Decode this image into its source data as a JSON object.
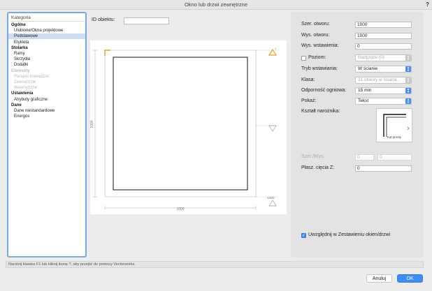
{
  "window": {
    "title": "Okno lub drzwi zewnętrzne",
    "help": "?"
  },
  "category_tree": {
    "header": "Kategoria",
    "items": [
      {
        "label": "Ogólne",
        "kind": "cat"
      },
      {
        "label": "Ulubione/Okna projektowe",
        "kind": "sub"
      },
      {
        "label": "Podstawowe",
        "kind": "sub",
        "selected": true
      },
      {
        "label": "Etykieta",
        "kind": "sub"
      },
      {
        "label": "Stolarka",
        "kind": "cat"
      },
      {
        "label": "Ramy",
        "kind": "sub"
      },
      {
        "label": "Skrzydła",
        "kind": "sub"
      },
      {
        "label": "Dodatki",
        "kind": "sub"
      },
      {
        "label": "Elementy",
        "kind": "cat",
        "disabled": true
      },
      {
        "label": "Parapet krawędzie",
        "kind": "sub",
        "disabled": true
      },
      {
        "label": "Zewnętrzne",
        "kind": "sub",
        "disabled": true
      },
      {
        "label": "Wewnętrzne",
        "kind": "sub",
        "disabled": true
      },
      {
        "label": "Ustawienia",
        "kind": "cat"
      },
      {
        "label": "Atrybuty graficzne",
        "kind": "sub"
      },
      {
        "label": "Dane",
        "kind": "cat"
      },
      {
        "label": "Dane niestandardowe",
        "kind": "sub"
      },
      {
        "label": "Energos",
        "kind": "sub"
      }
    ]
  },
  "object_id": {
    "label": "ID obiektu:",
    "value": ""
  },
  "preview": {
    "height_dim": "1000",
    "width_dim": "1000",
    "right_dim": "-1000",
    "top_tag": "0"
  },
  "form": {
    "width": {
      "label": "Szer. otworu:",
      "value": "1000"
    },
    "height": {
      "label": "Wys. otworu:",
      "value": "1000"
    },
    "insert_height": {
      "label": "Wys. wstawienia:",
      "value": "0"
    },
    "level": {
      "label": "Poziom:",
      "value": "Nadproże (0)",
      "checked": false
    },
    "insert_mode": {
      "label": "Tryb wstawiania:",
      "value": "W ścianie"
    },
    "class": {
      "label": "Klasa:",
      "value": "31 otwory w ściana..."
    },
    "fire": {
      "label": "Odporność ogniowa:",
      "value": "15 min"
    },
    "show": {
      "label": "Pokaż:",
      "value": "Tekst"
    },
    "corner": {
      "label": "Kształt narożnika:",
      "caption": "Kąt prosty"
    },
    "ratio": {
      "label": "Szer./Wys.",
      "value_a": "0",
      "value_b": "0"
    },
    "cut_plane": {
      "label": "Płasz. cięcia Z:",
      "value": "0"
    },
    "schedule": {
      "label": "Uwzględnij w Zestawieniu okien/drzwi",
      "checked": true
    }
  },
  "status": {
    "text": "Naciśnij klawisz F1 lub kliknij ikonę ?, aby przejść do pomocy Vectorworks."
  },
  "buttons": {
    "cancel": "Anuluj",
    "ok": "OK"
  },
  "colors": {
    "accent": "#3d8ef6",
    "marker": "#f0a020"
  }
}
